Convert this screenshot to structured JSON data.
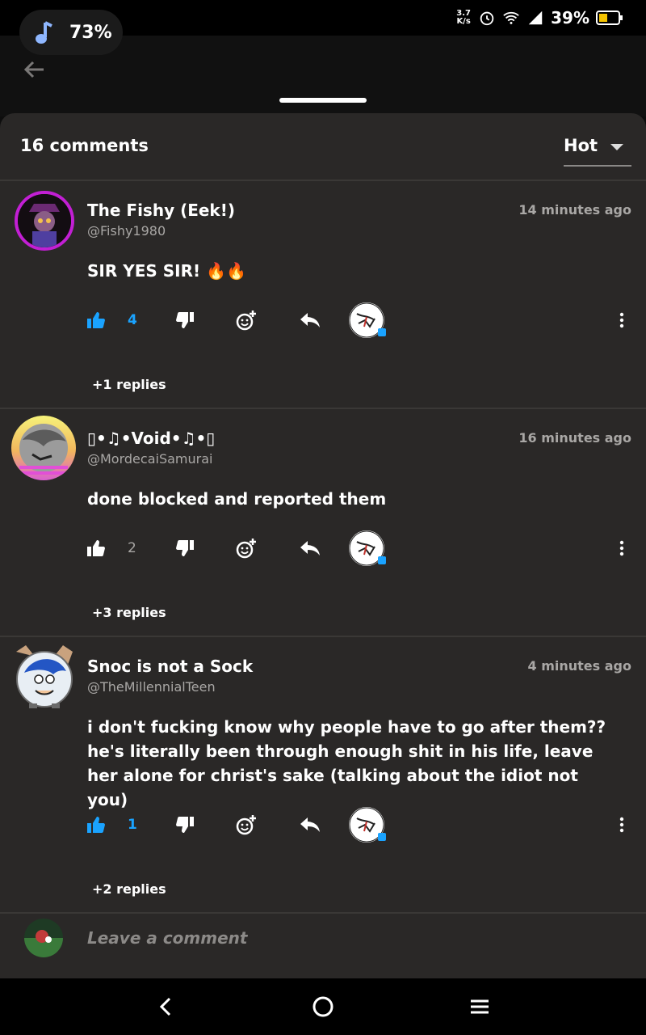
{
  "status_bar": {
    "media_percent": "73%",
    "net_speed_top": "3.7",
    "net_speed_bottom": "K/s",
    "battery_percent": "39%"
  },
  "sheet": {
    "comment_count": "16 comments",
    "sort_value": "Hot"
  },
  "comments": [
    {
      "name": "The Fishy (Eek!)",
      "handle": "@Fishy1980",
      "time": "14 minutes ago",
      "body": "SIR YES SIR! 🔥🔥",
      "likes": "4",
      "liked": true,
      "replies": "+1 replies"
    },
    {
      "name": "▯•♫•Void•♫•▯",
      "handle": "@MordecaiSamurai",
      "time": "16 minutes ago",
      "body": "done blocked and reported them",
      "likes": "2",
      "liked": false,
      "replies": "+3 replies"
    },
    {
      "name": "Snoc is not a Sock",
      "handle": "@TheMillennialTeen",
      "time": "4 minutes ago",
      "body": "i don't fucking know why people have to go after them?? he's literally been through enough shit in his life, leave her alone for christ's sake (talking about the idiot not you)",
      "likes": "1",
      "liked": true,
      "replies": "+2 replies"
    }
  ],
  "composer": {
    "placeholder": "Leave a comment"
  },
  "colors": {
    "accent_blue": "#1aa3ff",
    "sheet_bg": "#2a2827"
  }
}
